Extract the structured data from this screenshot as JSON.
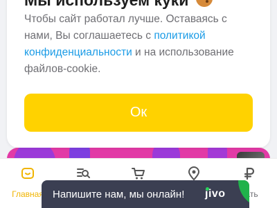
{
  "cookie_banner": {
    "title": "Мы используем куки",
    "text_before_link": "Чтобы сайт работал лучше. Оставаясь с нами, Вы соглашаетесь с ",
    "link_text": "политикой конфиденциальности",
    "text_after_link": " и на использование файлов-cookie.",
    "ok_label": "Ок"
  },
  "bottom_nav": {
    "items": [
      {
        "label": "Главная",
        "icon": "home-icon",
        "active": true
      },
      {
        "label": "",
        "icon": "catalog-search-icon",
        "active": false
      },
      {
        "label": "",
        "icon": "cart-icon",
        "active": false
      },
      {
        "label": "",
        "icon": "location-pin-icon",
        "active": false
      },
      {
        "label": "дать",
        "icon": "ruble-icon",
        "active": false
      }
    ]
  },
  "chat_widget": {
    "text": "Напишите нам, мы онлайн!",
    "logo": "jivo"
  },
  "colors": {
    "accent_yellow": "#ffd200",
    "link_blue": "#1a9be6",
    "chat_bg": "#3b3f52",
    "chat_green": "#20b24b",
    "promo_pink": "#e23aa6",
    "promo_purple": "#9b3ad9"
  }
}
